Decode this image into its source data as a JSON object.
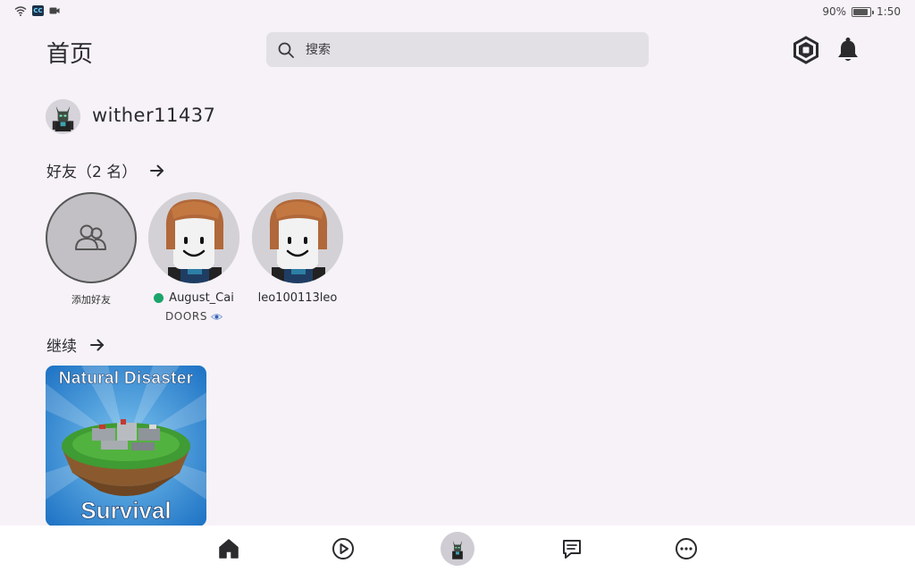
{
  "status_bar": {
    "left_badge": "CC",
    "battery": "90%",
    "battery_level": 0.9,
    "time": "1:50"
  },
  "header": {
    "title": "首页",
    "search_placeholder": "搜索",
    "icons": [
      "robux-icon",
      "bell-icon"
    ]
  },
  "profile": {
    "username": "wither11437"
  },
  "friends": {
    "heading": "好友（2 名）",
    "add_label": "添加好友",
    "items": [
      {
        "name": "August_Cai",
        "status": "online",
        "game": "DOORS"
      },
      {
        "name": "leo100113leo"
      }
    ]
  },
  "continue": {
    "heading": "继续",
    "games": [
      {
        "title_top": "Natural Disaster",
        "title_bottom": "Survival"
      }
    ]
  },
  "bottom_nav": {
    "items": [
      "home-icon",
      "play-icon",
      "avatar",
      "chat-icon",
      "more-icon"
    ]
  },
  "colors": {
    "background": "#f6f2f7",
    "online": "#1aa46b",
    "text": "#2b2b2e"
  }
}
